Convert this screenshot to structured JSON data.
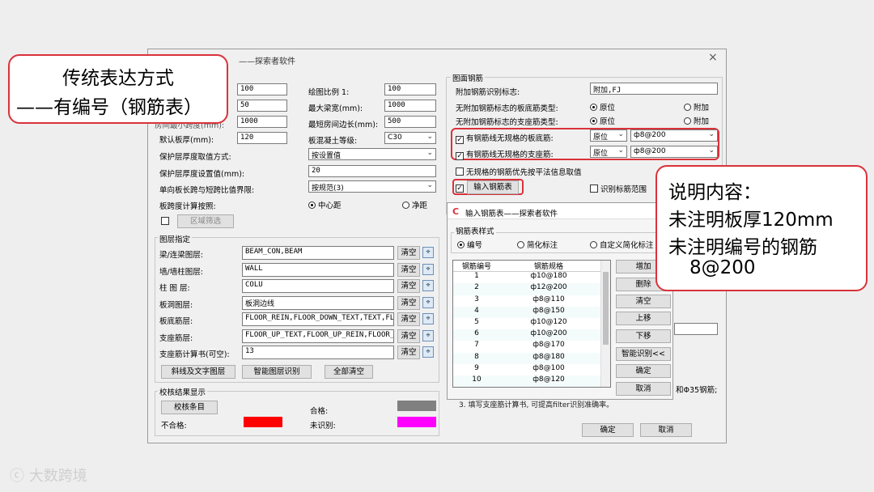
{
  "dialog": {
    "title": "——探索者软件",
    "close": "×",
    "left": {
      "top_fields": [
        "100",
        "50",
        "1000",
        "120"
      ],
      "top_labels_visible": [
        "房间最小跨度(mm):",
        "默认板厚(mm):"
      ],
      "scale_label": "绘图比例 1:",
      "scale_value": "100",
      "max_beam_label": "最大梁宽(mm):",
      "max_beam_value": "1000",
      "min_room_label": "最短房间边长(mm):",
      "min_room_value": "500",
      "concrete_label": "板混凝土等级:",
      "concrete_value": "C30",
      "cover_method_label": "保护层厚度取值方式:",
      "cover_method_value": "按设置值",
      "cover_value_label": "保护层厚度设置值(mm):",
      "cover_value": "20",
      "ratio_label": "单向板长跨与短跨比值界限:",
      "ratio_value": "按规范(3)",
      "span_label": "板跨度计算按照:",
      "span_opt1": "中心距",
      "span_opt2": "净距",
      "region_btn": "区域筛选"
    },
    "layers": {
      "group_title": "图层指定",
      "rows": [
        {
          "label": "梁/连梁图层:",
          "value": "BEAM_CON,BEAM",
          "clear": "清空"
        },
        {
          "label": "墙/墙柱图层:",
          "value": "WALL",
          "clear": "清空"
        },
        {
          "label": "柱 图 层:",
          "value": "COLU",
          "clear": "清空"
        },
        {
          "label": "板洞图层:",
          "value": "板洞边线",
          "clear": "清空"
        },
        {
          "label": "板底筋层:",
          "value": "FLOOR_REIN,FLOOR_DOWN_TEXT,TEXT,FL",
          "clear": "清空"
        },
        {
          "label": "支座筋层:",
          "value": "FLOOR_UP_TEXT,FLOOR_UP_REIN,FLOOR_",
          "clear": "清空"
        },
        {
          "label": "支座筋计算书(可空):",
          "value": "13",
          "clear": "清空"
        }
      ],
      "btn_diag": "斜线及文字图层",
      "btn_smart": "智能图层识别",
      "btn_clear_all": "全部清空"
    },
    "check": {
      "group_title": "校核结果显示",
      "btn": "校核条目",
      "ok_label": "合格:",
      "fail_label": "不合格:",
      "unknown_label": "未识别:",
      "ok_color": "#808080",
      "fail_color": "#ff0000",
      "unknown_color": "#ff00ff"
    },
    "right": {
      "group_title": "图面钢筋",
      "extra_label": "附加钢筋识别标志:",
      "extra_value": "附加,FJ",
      "noextra_bottom_label": "无附加钢筋标志的板底筋类型:",
      "noextra_support_label": "无附加钢筋标志的支座筋类型:",
      "opt_origin": "原位",
      "opt_extra": "附加",
      "irr_bottom_label": "有钢筋线无规格的板底筋:",
      "irr_support_label": "有钢筋线无规格的支座筋:",
      "irr_bottom_pos": "原位",
      "irr_bottom_spec": "ф8@200",
      "irr_support_pos": "原位",
      "irr_support_spec": "ф8@200",
      "no_spec_label": "无规格的钢筋优先按平法信息取值",
      "input_btn": "输入钢筋表",
      "identify_label": "识别标筋范围",
      "note_a": "和Φ35钢筋;",
      "note_b": "3. 填写支座筋计算书, 可提高filter识别准确率。"
    },
    "ok": "确定",
    "cancel": "取消"
  },
  "sub_dialog": {
    "title": "输入钢筋表——探索者软件",
    "style_label": "钢筋表样式",
    "opt_number": "编号",
    "opt_simple": "简化标注",
    "opt_custom": "自定义简化标注",
    "col_number": "钢筋编号",
    "col_spec": "钢筋规格",
    "rows": [
      {
        "n": "1",
        "s": "ф10@180"
      },
      {
        "n": "2",
        "s": "ф12@200"
      },
      {
        "n": "3",
        "s": "ф8@110"
      },
      {
        "n": "4",
        "s": "ф8@150"
      },
      {
        "n": "5",
        "s": "ф10@120"
      },
      {
        "n": "6",
        "s": "ф10@200"
      },
      {
        "n": "7",
        "s": "ф8@170"
      },
      {
        "n": "8",
        "s": "ф8@180"
      },
      {
        "n": "9",
        "s": "ф8@100"
      },
      {
        "n": "10",
        "s": "ф8@120"
      }
    ],
    "btn_add": "增加",
    "btn_del": "删除",
    "btn_clear": "清空",
    "btn_up": "上移",
    "btn_down": "下移",
    "btn_smart": "智能识别<<",
    "btn_ok": "确定",
    "btn_cancel": "取消"
  },
  "callout_left": {
    "line1": "传统表达方式",
    "line2": "——有编号（钢筋表）"
  },
  "callout_right": {
    "line1": "说明内容：",
    "line2": "未注明板厚120mm",
    "line3": "未注明编号的钢筋",
    "line4": "8@200"
  },
  "watermark": "大数跨境"
}
